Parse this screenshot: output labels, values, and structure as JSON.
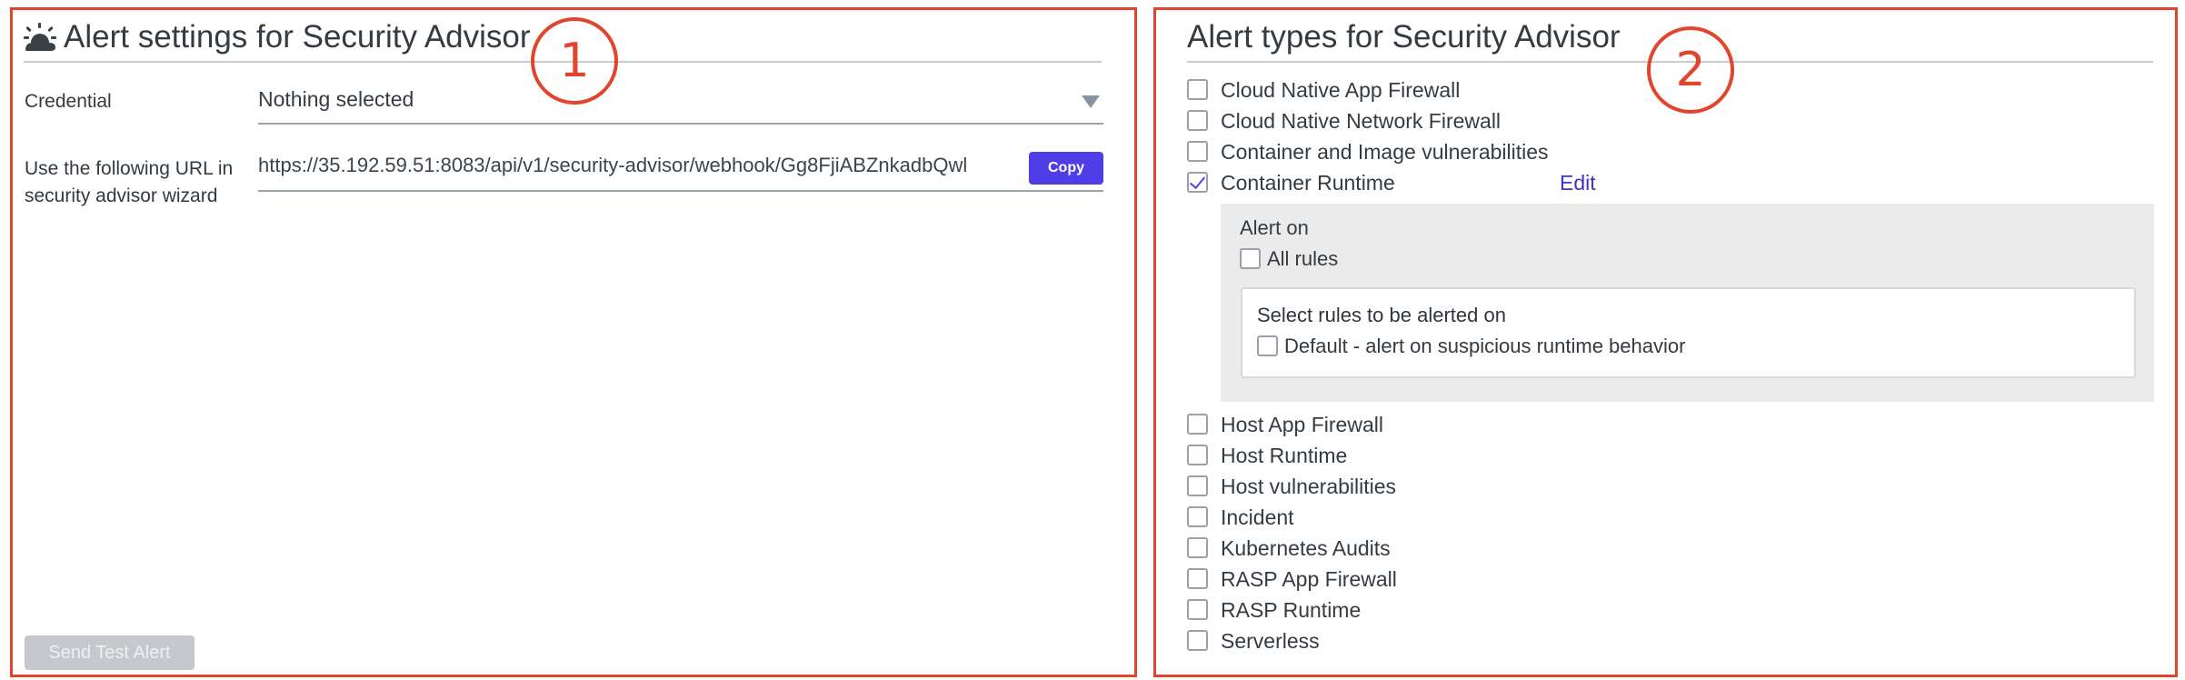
{
  "left_panel": {
    "title": "Alert settings for Security Advisor",
    "title_icon": "cloud-sun-icon",
    "step_number": "1",
    "credential": {
      "label": "Credential",
      "selected": "Nothing selected"
    },
    "url": {
      "label": "Use the following URL in security advisor wizard",
      "value": "https://35.192.59.51:8083/api/v1/security-advisor/webhook/Gg8FjiABZnkadbQwl",
      "copy_label": "Copy"
    },
    "send_test_label": "Send Test Alert"
  },
  "right_panel": {
    "title": "Alert types for Security Advisor",
    "step_number": "2",
    "alerts_before": [
      {
        "label": "Cloud Native App Firewall",
        "checked": false
      },
      {
        "label": "Cloud Native Network Firewall",
        "checked": false
      },
      {
        "label": "Container and Image vulnerabilities",
        "checked": false
      }
    ],
    "container_runtime": {
      "label": "Container Runtime",
      "checked": true,
      "edit_label": "Edit",
      "alert_on": "Alert on",
      "all_rules_label": "All rules",
      "all_rules_checked": false,
      "select_rules_title": "Select rules to be alerted on",
      "rule_label": "Default - alert on suspicious runtime behavior",
      "rule_checked": false
    },
    "alerts_after": [
      {
        "label": "Host App Firewall",
        "checked": false
      },
      {
        "label": "Host Runtime",
        "checked": false
      },
      {
        "label": "Host vulnerabilities",
        "checked": false
      },
      {
        "label": "Incident",
        "checked": false
      },
      {
        "label": "Kubernetes Audits",
        "checked": false
      },
      {
        "label": "RASP App Firewall",
        "checked": false
      },
      {
        "label": "RASP Runtime",
        "checked": false
      },
      {
        "label": "Serverless",
        "checked": false
      }
    ]
  },
  "colors": {
    "annotation": "#e2452d",
    "accent": "#4f3ee8",
    "link": "#3d36c7"
  }
}
